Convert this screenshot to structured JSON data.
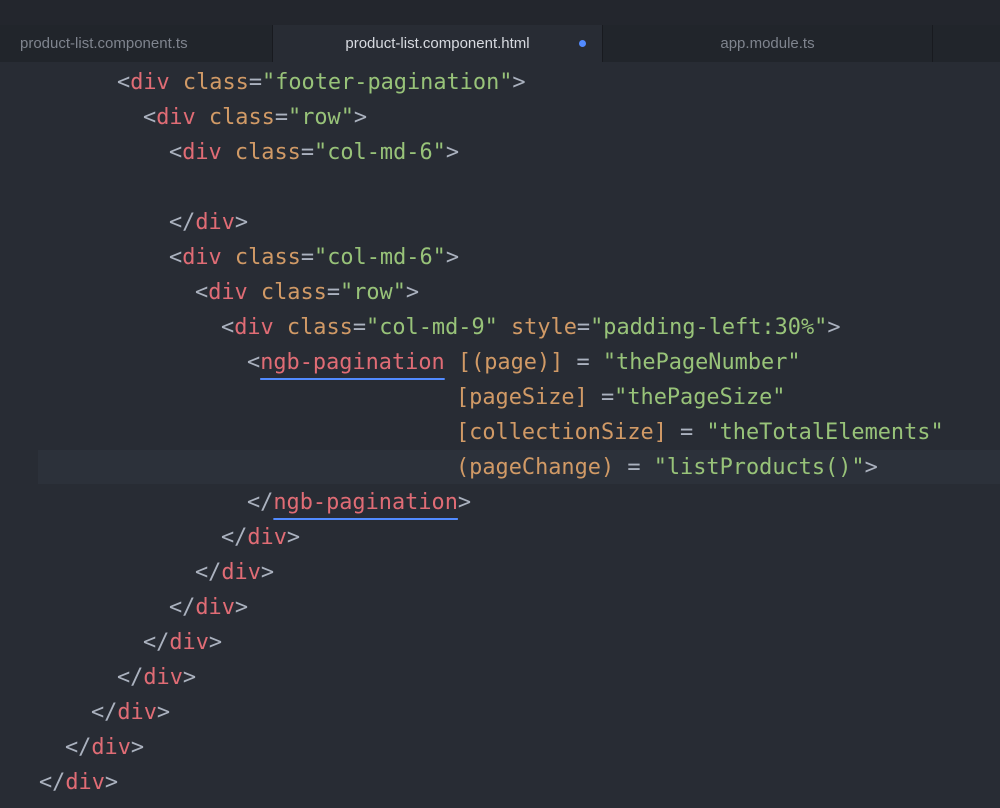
{
  "tabs": [
    {
      "label": "product-list.component.ts",
      "active": false
    },
    {
      "label": "product-list.component.html",
      "active": true,
      "modified": true
    },
    {
      "label": "app.module.ts",
      "active": false
    }
  ],
  "code": {
    "lines": [
      [
        [
          "p",
          "<"
        ],
        [
          "t",
          "div"
        ],
        [
          "p",
          " "
        ],
        [
          "a",
          "class"
        ],
        [
          "p",
          "="
        ],
        [
          "s",
          "\"footer-pagination\""
        ],
        [
          "p",
          ">"
        ]
      ],
      [
        [
          "p",
          "<"
        ],
        [
          "t",
          "div"
        ],
        [
          "p",
          " "
        ],
        [
          "a",
          "class"
        ],
        [
          "p",
          "="
        ],
        [
          "s",
          "\"row\""
        ],
        [
          "p",
          ">"
        ]
      ],
      [
        [
          "p",
          "<"
        ],
        [
          "t",
          "div"
        ],
        [
          "p",
          " "
        ],
        [
          "a",
          "class"
        ],
        [
          "p",
          "="
        ],
        [
          "s",
          "\"col-md-6\""
        ],
        [
          "p",
          ">"
        ]
      ],
      [],
      [
        [
          "p",
          "</"
        ],
        [
          "t",
          "div"
        ],
        [
          "p",
          ">"
        ]
      ],
      [
        [
          "p",
          "<"
        ],
        [
          "t",
          "div"
        ],
        [
          "p",
          " "
        ],
        [
          "a",
          "class"
        ],
        [
          "p",
          "="
        ],
        [
          "s",
          "\"col-md-6\""
        ],
        [
          "p",
          ">"
        ]
      ],
      [
        [
          "p",
          "<"
        ],
        [
          "t",
          "div"
        ],
        [
          "p",
          " "
        ],
        [
          "a",
          "class"
        ],
        [
          "p",
          "="
        ],
        [
          "s",
          "\"row\""
        ],
        [
          "p",
          ">"
        ]
      ],
      [
        [
          "p",
          "<"
        ],
        [
          "t",
          "div"
        ],
        [
          "p",
          " "
        ],
        [
          "a",
          "class"
        ],
        [
          "p",
          "="
        ],
        [
          "s",
          "\"col-md-9\""
        ],
        [
          "p",
          " "
        ],
        [
          "a",
          "style"
        ],
        [
          "p",
          "="
        ],
        [
          "s",
          "\"padding-left:30%\""
        ],
        [
          "p",
          ">"
        ]
      ],
      [
        [
          "p",
          "<"
        ],
        [
          "tu",
          "ngb-pagination"
        ],
        [
          "p",
          " "
        ],
        [
          "a",
          "[(page)]"
        ],
        [
          "p",
          " = "
        ],
        [
          "s",
          "\"thePageNumber\""
        ]
      ],
      [
        [
          "a",
          "[pageSize]"
        ],
        [
          "p",
          " ="
        ],
        [
          "s",
          "\"thePageSize\""
        ]
      ],
      [
        [
          "a",
          "[collectionSize]"
        ],
        [
          "p",
          " = "
        ],
        [
          "s",
          "\"theTotalElements\""
        ]
      ],
      [
        [
          "a",
          "(pageChange)"
        ],
        [
          "p",
          " = "
        ],
        [
          "s",
          "\"listProducts()\""
        ],
        [
          "p",
          ">"
        ]
      ],
      [
        [
          "p",
          "</"
        ],
        [
          "tu",
          "ngb-pagination"
        ],
        [
          "p",
          ">"
        ]
      ],
      [
        [
          "p",
          "</"
        ],
        [
          "t",
          "div"
        ],
        [
          "p",
          ">"
        ]
      ],
      [
        [
          "p",
          "</"
        ],
        [
          "t",
          "div"
        ],
        [
          "p",
          ">"
        ]
      ],
      [
        [
          "p",
          "</"
        ],
        [
          "t",
          "div"
        ],
        [
          "p",
          ">"
        ]
      ],
      [
        [
          "p",
          "</"
        ],
        [
          "t",
          "div"
        ],
        [
          "p",
          ">"
        ]
      ],
      [
        [
          "p",
          "</"
        ],
        [
          "t",
          "div"
        ],
        [
          "p",
          ">"
        ]
      ],
      [
        [
          "p",
          "</"
        ],
        [
          "t",
          "div"
        ],
        [
          "p",
          ">"
        ]
      ],
      [
        [
          "p",
          "</"
        ],
        [
          "t",
          "div"
        ],
        [
          "p",
          ">"
        ]
      ],
      [
        [
          "p",
          "</"
        ],
        [
          "t",
          "div"
        ],
        [
          "p",
          ">"
        ]
      ]
    ]
  }
}
